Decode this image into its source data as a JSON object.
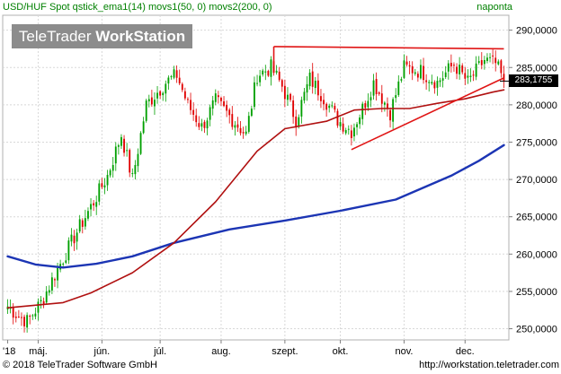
{
  "header": {
    "left": "USD/HUF Spot qstick_ema1(14) movs1(50, 0) movs2(200, 0)",
    "right": "naponta"
  },
  "logo": {
    "light": "TeleTrader",
    "bold": "WorkStation"
  },
  "footer": {
    "left": "© 2018 TeleTrader Software GmbH",
    "right": "http://workstation.teletrader.com"
  },
  "colors": {
    "up": "#00a000",
    "down": "#e00000",
    "movs1": "#b01010",
    "movs2": "#1c35b4",
    "trend": "#e01515",
    "frame": "#b0b0b0",
    "grid": "#d8d8d8"
  },
  "chart_data": {
    "type": "candlestick",
    "title": "USD/HUF Spot",
    "interval": "naponta",
    "x_tick_labels": [
      "'18",
      "máj.",
      "jún.",
      "júl.",
      "aug.",
      "szept.",
      "okt.",
      "nov.",
      "dec."
    ],
    "y_tick_labels": [
      "250,0000",
      "255,0000",
      "260,0000",
      "265,0000",
      "270,0000",
      "275,0000",
      "280,0000",
      "285,0000",
      "290,0000"
    ],
    "ylim": [
      248.5,
      292
    ],
    "last_value": "283,1755",
    "sessions": 180,
    "first_session": "2018-04-16",
    "grid": true,
    "series": [
      {
        "name": "movs1(50, 0)",
        "type": "line",
        "points": [
          [
            0,
            252.8
          ],
          [
            20,
            253.5
          ],
          [
            30,
            254.8
          ],
          [
            45,
            257.5
          ],
          [
            60,
            261.5
          ],
          [
            75,
            267.0
          ],
          [
            90,
            273.8
          ],
          [
            100,
            276.8
          ],
          [
            115,
            277.8
          ],
          [
            125,
            279.3
          ],
          [
            135,
            279.5
          ],
          [
            145,
            279.5
          ],
          [
            155,
            280.2
          ],
          [
            165,
            280.8
          ],
          [
            175,
            281.7
          ],
          [
            179,
            282.0
          ]
        ]
      },
      {
        "name": "movs2(200, 0)",
        "type": "line",
        "points": [
          [
            0,
            259.7
          ],
          [
            10,
            258.6
          ],
          [
            20,
            258.2
          ],
          [
            32,
            258.7
          ],
          [
            45,
            259.7
          ],
          [
            60,
            261.5
          ],
          [
            80,
            263.3
          ],
          [
            100,
            264.5
          ],
          [
            120,
            265.8
          ],
          [
            140,
            267.3
          ],
          [
            160,
            270.5
          ],
          [
            170,
            272.5
          ],
          [
            179,
            274.6
          ]
        ]
      },
      {
        "name": "trendlines",
        "type": "line",
        "segments": [
          [
            [
              96,
              287.8
            ],
            [
              179,
              287.5
            ]
          ],
          [
            [
              96,
              287.8
            ],
            [
              96,
              285.2
            ]
          ],
          [
            [
              124,
              274.0
            ],
            [
              179,
              283.6
            ]
          ]
        ]
      }
    ],
    "ohlc_anchors": [
      [
        0,
        253.0
      ],
      [
        3,
        252.0
      ],
      [
        7,
        251.0
      ],
      [
        12,
        253.5
      ],
      [
        18,
        258.0
      ],
      [
        25,
        263.0
      ],
      [
        31,
        267.0
      ],
      [
        36,
        270.5
      ],
      [
        41,
        276.0
      ],
      [
        45,
        270.0
      ],
      [
        50,
        280.0
      ],
      [
        57,
        283.0
      ],
      [
        61,
        284.0
      ],
      [
        65,
        280.0
      ],
      [
        70,
        277.0
      ],
      [
        75,
        280.5
      ],
      [
        80,
        278.5
      ],
      [
        86,
        276.0
      ],
      [
        90,
        284.0
      ],
      [
        95,
        285.0
      ],
      [
        99,
        282.5
      ],
      [
        104,
        278.0
      ],
      [
        109,
        283.5
      ],
      [
        114,
        281.0
      ],
      [
        119,
        278.0
      ],
      [
        124,
        276.5
      ],
      [
        128,
        279.5
      ],
      [
        132,
        283.0
      ],
      [
        138,
        279.0
      ],
      [
        143,
        285.0
      ],
      [
        149,
        284.5
      ],
      [
        155,
        283.0
      ],
      [
        161,
        285.5
      ],
      [
        166,
        283.0
      ],
      [
        172,
        286.0
      ],
      [
        176,
        285.5
      ],
      [
        179,
        283.18
      ]
    ]
  }
}
